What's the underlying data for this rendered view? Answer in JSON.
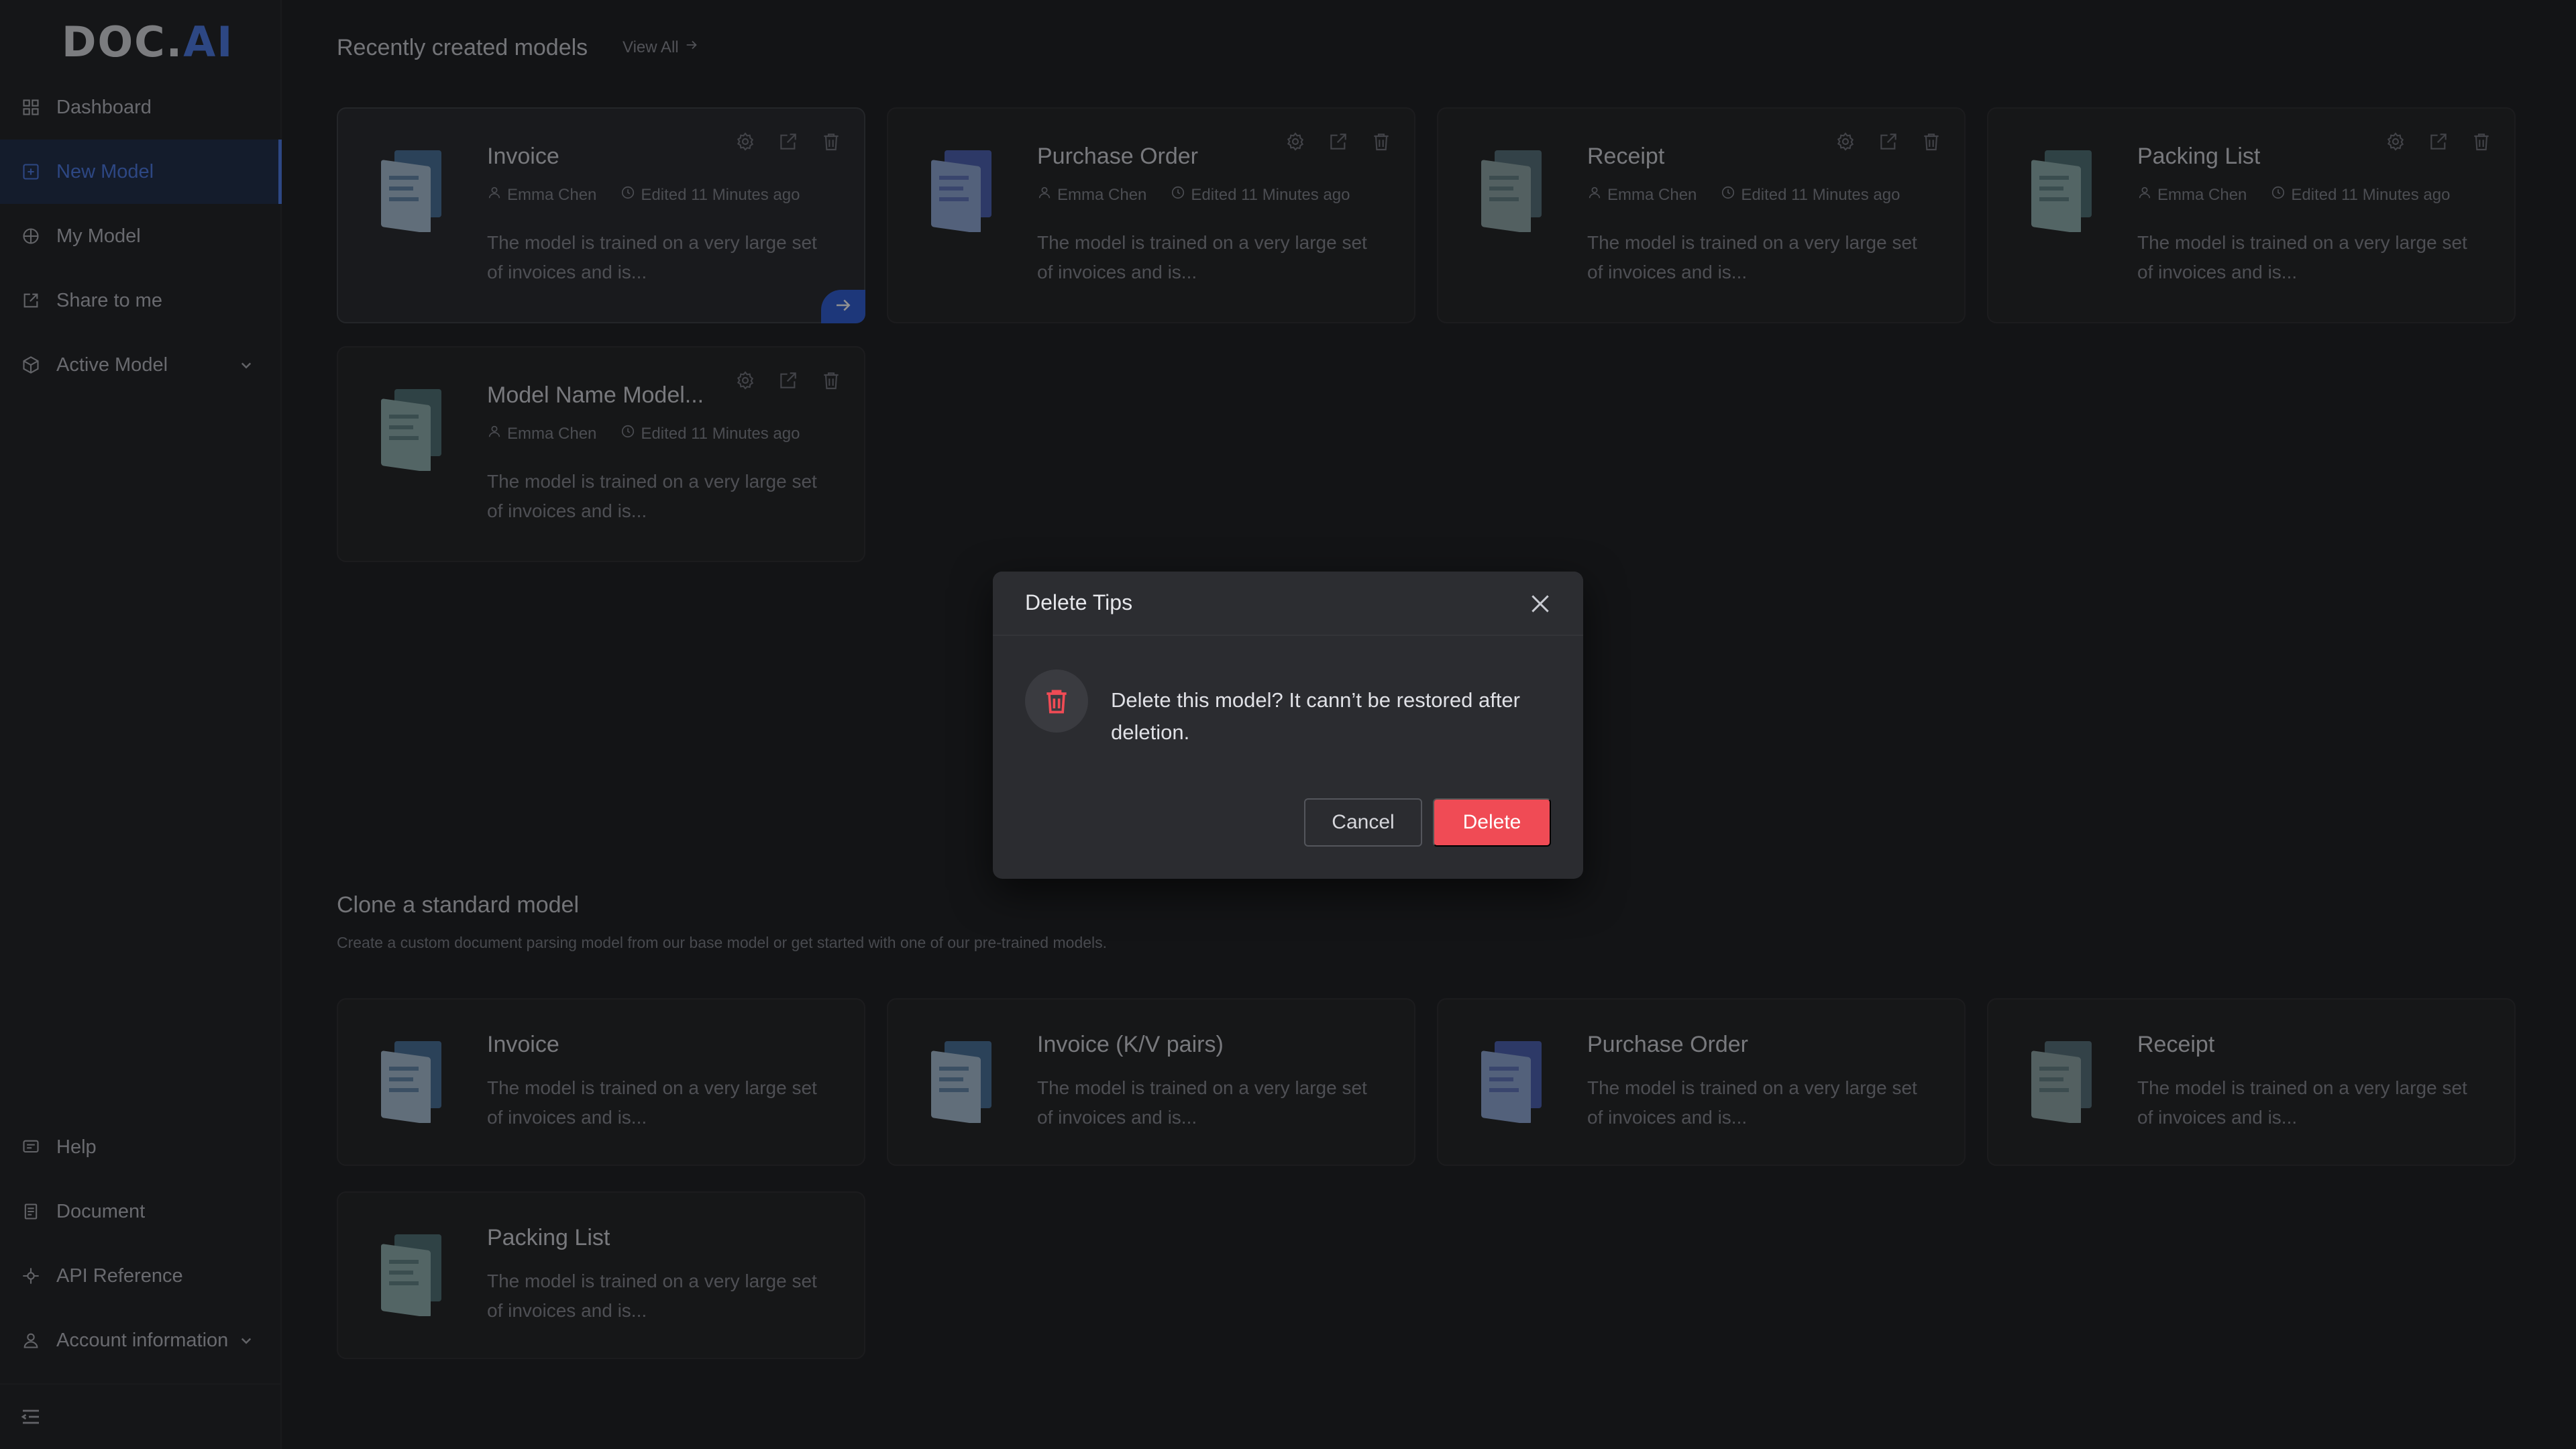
{
  "brand": {
    "logo_main": "DOC.",
    "logo_accent": "AI"
  },
  "sidebar": {
    "items": [
      {
        "label": "Dashboard",
        "icon": "dashboard-icon"
      },
      {
        "label": "New Model",
        "icon": "plus-square-icon",
        "active": true
      },
      {
        "label": "My Model",
        "icon": "model-icon"
      },
      {
        "label": "Share to me",
        "icon": "share-icon"
      },
      {
        "label": "Active Model",
        "icon": "cube-icon",
        "has_submenu": true
      }
    ],
    "bottom_items": [
      {
        "label": "Help",
        "icon": "help-icon"
      },
      {
        "label": "Document",
        "icon": "document-icon"
      },
      {
        "label": "API Reference",
        "icon": "api-icon"
      },
      {
        "label": "Account information",
        "icon": "user-icon",
        "has_submenu": true
      }
    ]
  },
  "recent": {
    "title": "Recently created models",
    "view_all": "View All",
    "cards": [
      {
        "name": "Invoice",
        "author": "Emma Chen",
        "edited": "Edited 11 Minutes ago",
        "desc": "The model is trained on a very large set of invoices and is...",
        "thumb": "invoice"
      },
      {
        "name": "Purchase Order",
        "author": "Emma Chen",
        "edited": "Edited 11 Minutes ago",
        "desc": "The model is trained on a very large set of invoices and is...",
        "thumb": "po"
      },
      {
        "name": "Receipt",
        "author": "Emma Chen",
        "edited": "Edited 11 Minutes ago",
        "desc": "The model is trained on a very large set of invoices and is...",
        "thumb": "receipt"
      },
      {
        "name": "Packing List",
        "author": "Emma Chen",
        "edited": "Edited 11 Minutes ago",
        "desc": "The model is trained on a very large set of invoices and is...",
        "thumb": "packing"
      },
      {
        "name": "Model Name Model...",
        "author": "Emma Chen",
        "edited": "Edited 11 Minutes ago",
        "desc": "The model is trained on a very large set of invoices and is...",
        "thumb": "packing"
      }
    ]
  },
  "clone": {
    "title": "Clone a standard model",
    "subtitle": "Create a custom document parsing model from our base model or get started with one of our pre-trained models.",
    "cards": [
      {
        "name": "Invoice",
        "desc": "The model is trained on a very large set of invoices and is...",
        "thumb": "invoice"
      },
      {
        "name": "Invoice (K/V pairs)",
        "desc": "The model is trained on a very large set of invoices and is...",
        "thumb": "invoice"
      },
      {
        "name": "Purchase Order",
        "desc": "The model is trained on a very large set of invoices and is...",
        "thumb": "po"
      },
      {
        "name": "Receipt",
        "desc": "The model is trained on a very large set of invoices and is...",
        "thumb": "receipt"
      },
      {
        "name": "Packing List",
        "desc": "The model is trained on a very large set of invoices and is...",
        "thumb": "packing"
      }
    ]
  },
  "modal": {
    "title": "Delete Tips",
    "message": "Delete this model? It cann’t be restored after deletion.",
    "cancel_label": "Cancel",
    "delete_label": "Delete"
  },
  "colors": {
    "accent": "#4a78e6",
    "danger": "#f04b55",
    "background": "#1b1c1f"
  }
}
